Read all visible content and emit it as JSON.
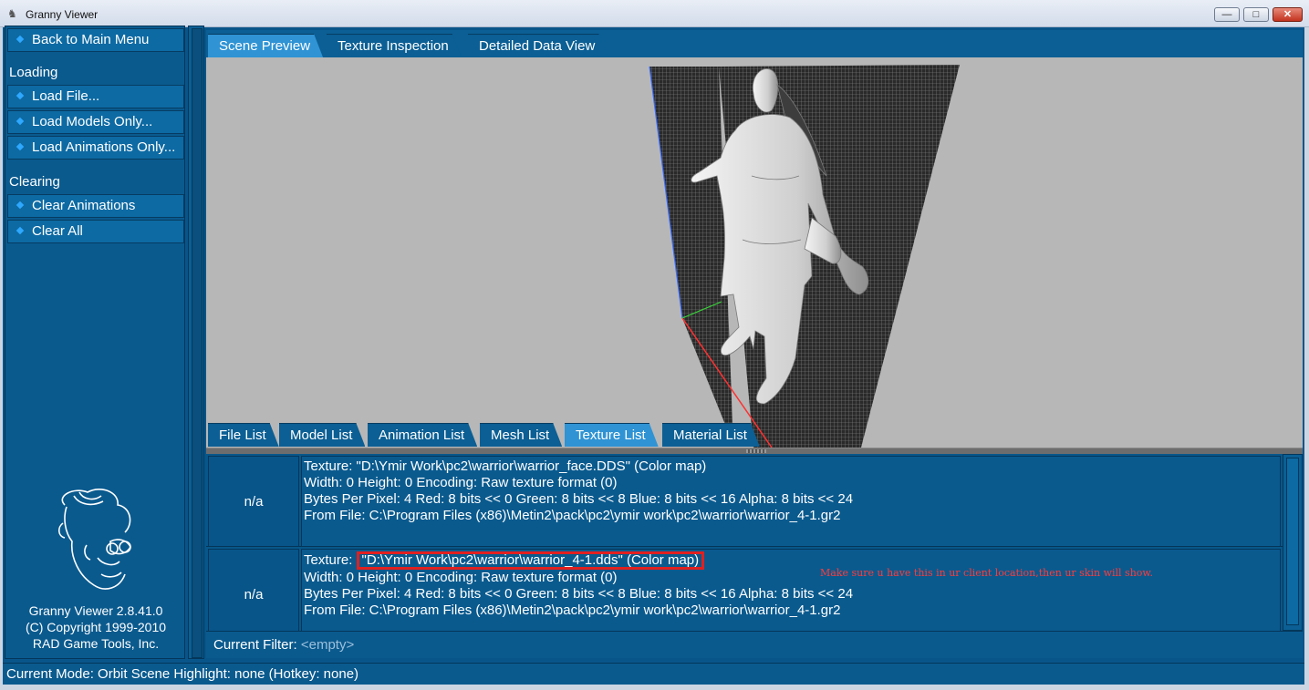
{
  "window": {
    "title": "Granny Viewer",
    "minimize_glyph": "—",
    "maximize_glyph": "□",
    "close_glyph": "✕"
  },
  "sidebar": {
    "back_label": "Back to Main Menu",
    "loading_section": "Loading",
    "load_file": "Load File...",
    "load_models": "Load Models Only...",
    "load_animations": "Load Animations Only...",
    "clearing_section": "Clearing",
    "clear_animations": "Clear Animations",
    "clear_all": "Clear All",
    "version_line1": "Granny Viewer 2.8.41.0",
    "version_line2": "(C) Copyright 1999-2010",
    "version_line3": "RAD Game Tools, Inc."
  },
  "top_tabs": [
    "Scene Preview",
    "Texture Inspection",
    "Detailed Data View"
  ],
  "active_top_tab": "Scene Preview",
  "bottom_tabs": [
    "File List",
    "Model List",
    "Animation List",
    "Mesh List",
    "Texture List",
    "Material List"
  ],
  "active_bottom_tab": "Texture List",
  "textures": [
    {
      "thumb": "n/a",
      "line1_prefix": "Texture: ",
      "line1_path": "\"D:\\Ymir Work\\pc2\\warrior\\warrior_face.DDS\" (Color map)",
      "line2": "Width: 0    Height: 0    Encoding: Raw texture format (0)",
      "line3": "Bytes Per Pixel: 4    Red: 8 bits << 0    Green: 8 bits << 8    Blue: 8 bits << 16    Alpha: 8 bits << 24",
      "line4": "From File: C:\\Program Files (x86)\\Metin2\\pack\\pc2\\ymir work\\pc2\\warrior\\warrior_4-1.gr2"
    },
    {
      "thumb": "n/a",
      "line1_prefix": "Texture: ",
      "line1_path": "\"D:\\Ymir Work\\pc2\\warrior\\warrior_4-1.dds\" (Color map)",
      "line2": "Width: 0    Height: 0    Encoding: Raw texture format (0)",
      "line3": "Bytes Per Pixel: 4    Red: 8 bits << 0    Green: 8 bits << 8    Blue: 8 bits << 16    Alpha: 8 bits << 24",
      "line4": "From File: C:\\Program Files (x86)\\Metin2\\pack\\pc2\\ymir work\\pc2\\warrior\\warrior_4-1.gr2"
    }
  ],
  "annotation": "Make sure u have this in ur client location,then ur skin will show.",
  "filter": {
    "label": "Current Filter: ",
    "value": "<empty>"
  },
  "status": {
    "text": "Current Mode: Orbit Scene    Highlight: none (Hotkey: none)"
  },
  "colors": {
    "panel": "#0a5a8e",
    "accent_tab": "#2f93d4",
    "viewport_bg": "#b7b7b7",
    "annotation_red": "#ff3b3b"
  }
}
